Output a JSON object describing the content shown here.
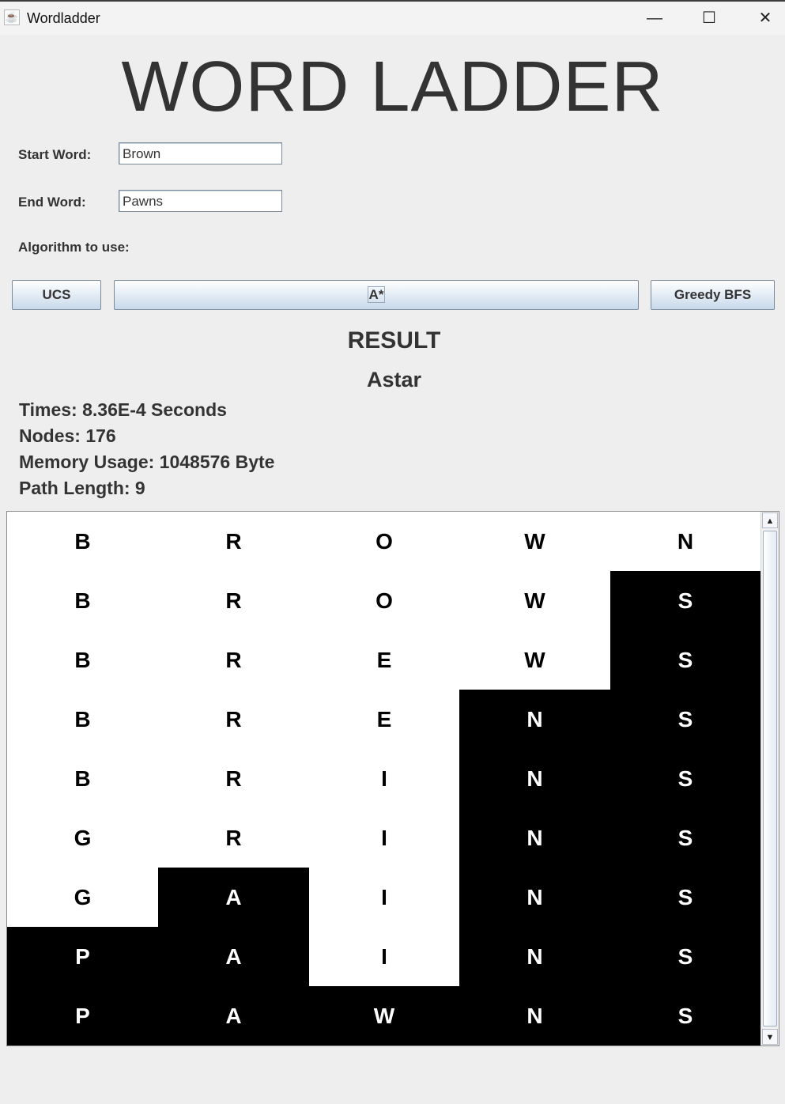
{
  "window": {
    "title": "Wordladder",
    "app_icon": "java-cup-icon",
    "controls": {
      "minimize": "—",
      "maximize": "☐",
      "close": "✕"
    }
  },
  "header": {
    "title": "WORD LADDER"
  },
  "form": {
    "start_label": "Start Word:",
    "start_value": "Brown",
    "end_label": "End Word:",
    "end_value": "Pawns",
    "algorithm_label": "Algorithm to use:"
  },
  "buttons": {
    "ucs": "UCS",
    "astar": "A*",
    "greedy": "Greedy BFS"
  },
  "result": {
    "title": "RESULT",
    "algorithm": "Astar",
    "times": "Times: 8.36E-4 Seconds",
    "nodes": "Nodes: 176",
    "memory": "Memory Usage: 1048576 Byte",
    "path_length": "Path Length: 9"
  },
  "ladder": {
    "rows": [
      {
        "letters": [
          "B",
          "R",
          "O",
          "W",
          "N"
        ],
        "shaded": [
          false,
          false,
          false,
          false,
          false
        ]
      },
      {
        "letters": [
          "B",
          "R",
          "O",
          "W",
          "S"
        ],
        "shaded": [
          false,
          false,
          false,
          false,
          true
        ]
      },
      {
        "letters": [
          "B",
          "R",
          "E",
          "W",
          "S"
        ],
        "shaded": [
          false,
          false,
          false,
          false,
          true
        ]
      },
      {
        "letters": [
          "B",
          "R",
          "E",
          "N",
          "S"
        ],
        "shaded": [
          false,
          false,
          false,
          true,
          true
        ]
      },
      {
        "letters": [
          "B",
          "R",
          "I",
          "N",
          "S"
        ],
        "shaded": [
          false,
          false,
          false,
          true,
          true
        ]
      },
      {
        "letters": [
          "G",
          "R",
          "I",
          "N",
          "S"
        ],
        "shaded": [
          false,
          false,
          false,
          true,
          true
        ]
      },
      {
        "letters": [
          "G",
          "A",
          "I",
          "N",
          "S"
        ],
        "shaded": [
          false,
          true,
          false,
          true,
          true
        ]
      },
      {
        "letters": [
          "P",
          "A",
          "I",
          "N",
          "S"
        ],
        "shaded": [
          true,
          true,
          false,
          true,
          true
        ]
      },
      {
        "letters": [
          "P",
          "A",
          "W",
          "N",
          "S"
        ],
        "shaded": [
          true,
          true,
          true,
          true,
          true
        ]
      }
    ]
  },
  "colors": {
    "shaded": "#000000",
    "unshaded": "#ffffff",
    "background": "#eeeeee",
    "text": "#333333"
  }
}
